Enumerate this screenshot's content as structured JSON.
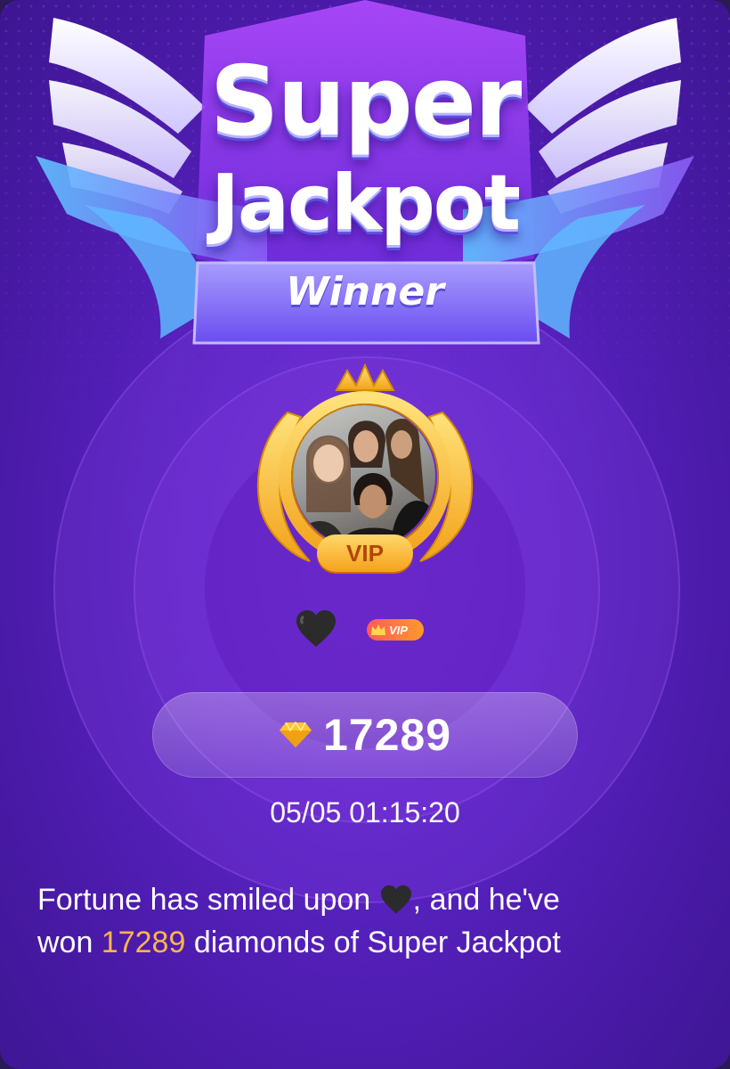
{
  "banner": {
    "title_line1": "Super",
    "title_line2": "Jackpot",
    "ribbon_label": "Winner"
  },
  "winner": {
    "avatar_badge": "VIP",
    "name_icon": "black-heart-icon",
    "level_badge": "VIP"
  },
  "prize": {
    "icon": "diamond-icon",
    "amount": "17289"
  },
  "timestamp": "05/05 01:15:20",
  "message": {
    "part1": "Fortune has smiled upon",
    "part2": ", and he've",
    "part3": "won",
    "amount": "17289",
    "part4": "diamonds of Super Jackpot"
  },
  "colors": {
    "background": "#5a23c4",
    "highlight": "#ffb54a",
    "gold": "#f6a11b"
  }
}
